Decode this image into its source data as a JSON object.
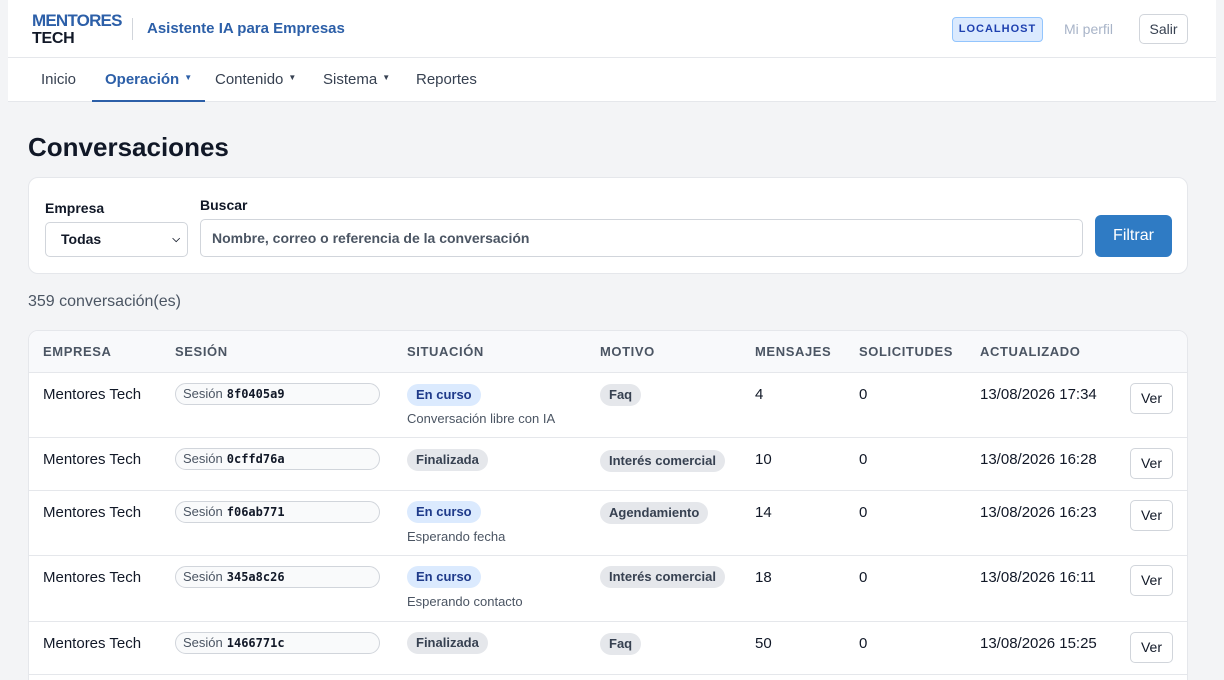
{
  "header": {
    "logo_line1": "MENTORES",
    "logo_line2": "TECH",
    "app_title": "Asistente IA para Empresas",
    "env_badge": "LOCALHOST",
    "profile_link": "Mi perfil",
    "logout_label": "Salir"
  },
  "nav": {
    "items": [
      {
        "label": "Inicio"
      },
      {
        "label": "Operación"
      },
      {
        "label": "Contenido"
      },
      {
        "label": "Sistema"
      },
      {
        "label": "Reportes"
      }
    ]
  },
  "page": {
    "title": "Conversaciones",
    "count": "359 conversación(es)"
  },
  "filters": {
    "company_label": "Empresa",
    "company_value": "Todas",
    "search_label": "Buscar",
    "search_placeholder": "Nombre, correo o referencia de la conversación",
    "submit_label": "Filtrar"
  },
  "table": {
    "headers": [
      "EMPRESA",
      "SESIÓN",
      "SITUACIÓN",
      "MOTIVO",
      "MENSAJES",
      "SOLICITUDES",
      "ACTUALIZADO"
    ],
    "session_prefix": "Sesión",
    "action_label": "Ver",
    "rows": [
      {
        "empresa": "Mentores Tech",
        "sesion": "8f0405a9",
        "situacion": "En curso",
        "detalle": "Conversación libre con IA",
        "motivo": "Faq",
        "mensajes": "4",
        "solicitudes": "0",
        "actualizado": "13/08/2026 17:34"
      },
      {
        "empresa": "Mentores Tech",
        "sesion": "0cffd76a",
        "situacion": "Finalizada",
        "detalle": "",
        "motivo": "Interés comercial",
        "mensajes": "10",
        "solicitudes": "0",
        "actualizado": "13/08/2026 16:28"
      },
      {
        "empresa": "Mentores Tech",
        "sesion": "f06ab771",
        "situacion": "En curso",
        "detalle": "Esperando fecha",
        "motivo": "Agendamiento",
        "mensajes": "14",
        "solicitudes": "0",
        "actualizado": "13/08/2026 16:23"
      },
      {
        "empresa": "Mentores Tech",
        "sesion": "345a8c26",
        "situacion": "En curso",
        "detalle": "Esperando contacto",
        "motivo": "Interés comercial",
        "mensajes": "18",
        "solicitudes": "0",
        "actualizado": "13/08/2026 16:11"
      },
      {
        "empresa": "Mentores Tech",
        "sesion": "1466771c",
        "situacion": "Finalizada",
        "detalle": "",
        "motivo": "Faq",
        "mensajes": "50",
        "solicitudes": "0",
        "actualizado": "13/08/2026 15:25"
      }
    ]
  }
}
